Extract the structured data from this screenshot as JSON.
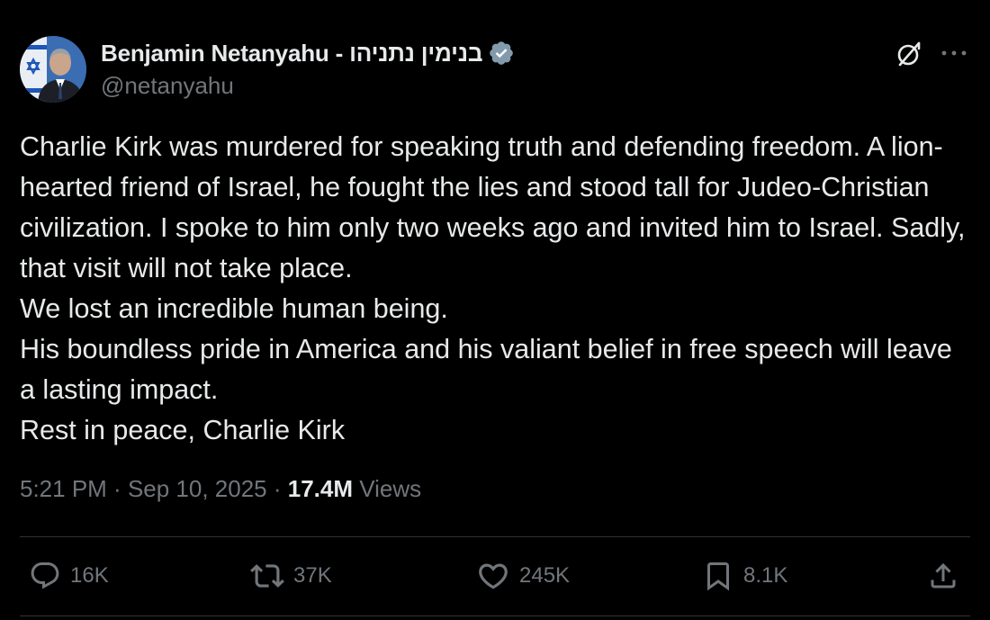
{
  "author": {
    "display_name": "Benjamin Netanyahu - בנימין נתניהו",
    "handle": "@netanyahu",
    "verified": true,
    "avatar": "profile-photo",
    "verified_badge_color": "#829aab"
  },
  "header_icons": {
    "grok": "grok-icon",
    "more": "more-icon"
  },
  "tweet": {
    "paragraphs": [
      "Charlie Kirk was murdered for speaking truth and defending freedom. A lion-hearted friend of Israel, he fought the lies and stood tall for Judeo-Christian civilization. I spoke to him only two weeks ago and invited him to Israel. Sadly, that visit will not take place.",
      "We lost an incredible human being.",
      "His boundless pride in America and his valiant belief in free speech will leave a lasting impact.",
      "Rest in peace, Charlie Kirk"
    ]
  },
  "meta": {
    "time": "5:21 PM",
    "separator": " · ",
    "date": "Sep 10, 2025",
    "views_count": "17.4M",
    "views_label": " Views"
  },
  "actions": {
    "replies": {
      "icon": "reply-icon",
      "count": "16K"
    },
    "reposts": {
      "icon": "repost-icon",
      "count": "37K"
    },
    "likes": {
      "icon": "heart-icon",
      "count": "245K"
    },
    "bookmarks": {
      "icon": "bookmark-icon",
      "count": "8.1K"
    },
    "share": {
      "icon": "share-icon"
    }
  },
  "colors": {
    "background": "#000000",
    "text": "#e7e9ea",
    "secondary": "#71767b",
    "divider": "#2f3336"
  }
}
